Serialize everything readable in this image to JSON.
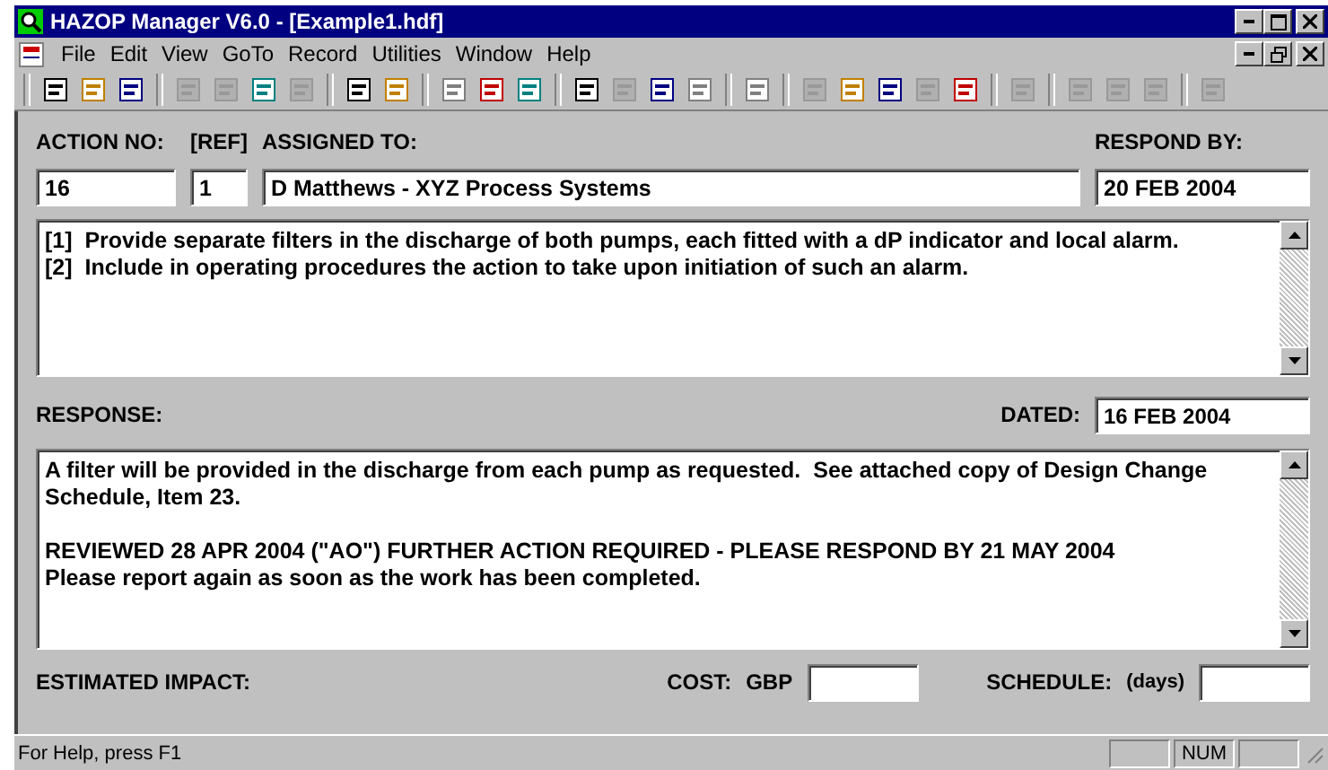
{
  "window": {
    "title": "HAZOP Manager V6.0 - [Example1.hdf]"
  },
  "menu": [
    "File",
    "Edit",
    "View",
    "GoTo",
    "Record",
    "Utilities",
    "Window",
    "Help"
  ],
  "toolbar": [
    [
      {
        "disabled": false
      },
      {
        "disabled": false
      },
      {
        "disabled": false
      }
    ],
    [
      {
        "disabled": true
      },
      {
        "disabled": true
      },
      {
        "disabled": false
      },
      {
        "disabled": true
      }
    ],
    [
      {
        "disabled": false
      },
      {
        "disabled": false
      }
    ],
    [
      {
        "disabled": false
      },
      {
        "disabled": false
      },
      {
        "disabled": false
      }
    ],
    [
      {
        "disabled": false
      },
      {
        "disabled": true
      },
      {
        "disabled": false
      },
      {
        "disabled": false
      }
    ],
    [
      {
        "disabled": false
      }
    ],
    [
      {
        "disabled": true
      },
      {
        "disabled": false
      },
      {
        "disabled": false
      },
      {
        "disabled": true
      },
      {
        "disabled": false
      }
    ],
    [
      {
        "disabled": true
      }
    ],
    [
      {
        "disabled": true
      },
      {
        "disabled": true
      },
      {
        "disabled": true
      }
    ],
    [
      {
        "disabled": true
      }
    ]
  ],
  "action": {
    "number_label": "ACTION NO:",
    "number": "16",
    "ref_label": "[REF]",
    "ref": "1",
    "assigned_label": "ASSIGNED TO:",
    "assigned": "D Matthews - XYZ Process Systems",
    "respond_label": "RESPOND BY:",
    "respond": "20 FEB 2004",
    "text": [
      "[1]  Provide separate filters in the discharge of both pumps, each fitted with a dP indicator and local alarm.",
      "[2]  Include in operating procedures the action to take upon initiation of such an alarm."
    ]
  },
  "response": {
    "label": "RESPONSE:",
    "dated_label": "DATED:",
    "dated": "16 FEB 2004",
    "paragraphs": [
      [
        "A filter will be provided in the discharge from each pump as requested.  See attached copy of Design Change Schedule, Item 23."
      ],
      [
        "REVIEWED 28 APR 2004 (\"AO\") FURTHER ACTION REQUIRED - PLEASE RESPOND BY 21 MAY 2004",
        "Please report again as soon as the work has been completed."
      ]
    ]
  },
  "impact": {
    "label": "ESTIMATED IMPACT:",
    "cost_label": "COST:",
    "cost_unit": "GBP",
    "schedule_label": "SCHEDULE:",
    "schedule_unit": "(days)"
  },
  "status_bar": {
    "text": "For Help, press F1",
    "num": "NUM"
  }
}
